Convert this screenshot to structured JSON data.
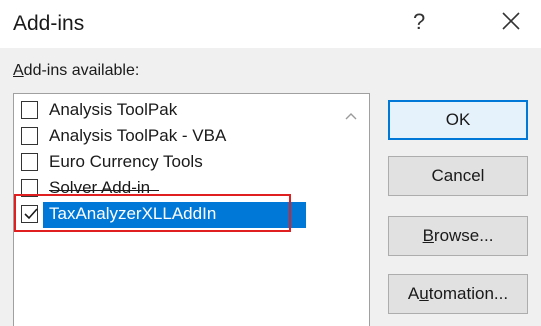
{
  "window": {
    "title": "Add-ins",
    "help_label": "?"
  },
  "available_label": "Add-ins available:",
  "addins": [
    {
      "label": "Analysis ToolPak",
      "checked": false,
      "selected": false
    },
    {
      "label": "Analysis ToolPak - VBA",
      "checked": false,
      "selected": false
    },
    {
      "label": "Euro Currency Tools",
      "checked": false,
      "selected": false
    },
    {
      "label": "Solver Add-in",
      "checked": false,
      "selected": false
    },
    {
      "label": "TaxAnalyzerXLLAddIn",
      "checked": true,
      "selected": true
    }
  ],
  "buttons": {
    "ok": "OK",
    "cancel": "Cancel",
    "browse": "Browse...",
    "automation": "Automation..."
  },
  "colors": {
    "selection": "#0078d7",
    "highlight_box": "#e02020"
  },
  "icons": {
    "close": "close-icon",
    "scroll_up": "chevron-up-icon",
    "checkmark": "checkmark-icon"
  }
}
